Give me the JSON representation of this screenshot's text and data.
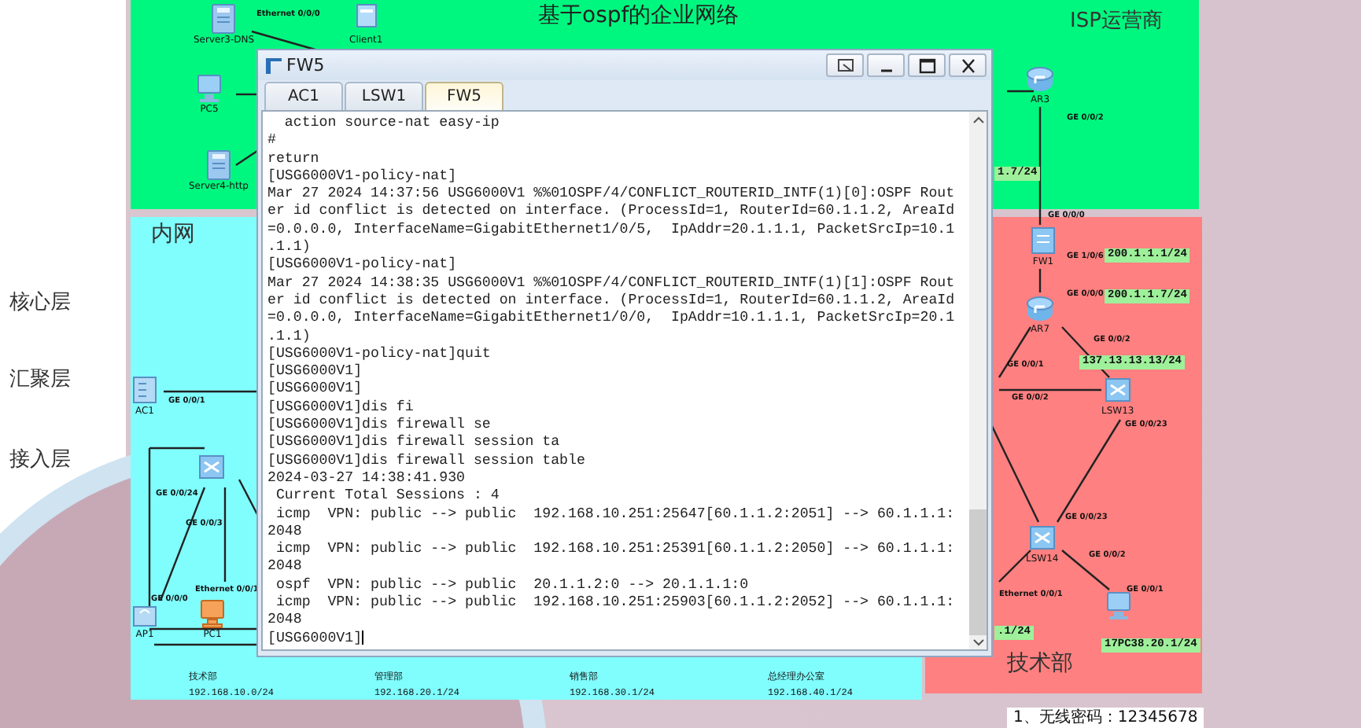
{
  "diagram": {
    "title": "基于ospf的企业网络",
    "zones": [
      {
        "kind": "isp",
        "label": "ISP运营商"
      },
      {
        "kind": "intranet",
        "label": "内网"
      },
      {
        "kind": "tech",
        "label": "技术部"
      }
    ],
    "layers": [
      "核心层",
      "汇聚层",
      "接入层"
    ],
    "devices": [
      {
        "kind": "server",
        "label": "Server3-DNS"
      },
      {
        "kind": "pc",
        "label": "PC5"
      },
      {
        "kind": "server",
        "label": "Server4-http"
      },
      {
        "kind": "client",
        "label": "Client1"
      },
      {
        "kind": "router",
        "label": "AR3"
      },
      {
        "kind": "firewall",
        "label": "FW1"
      },
      {
        "kind": "router",
        "label": "AR7"
      },
      {
        "kind": "switch",
        "label": "LSW13"
      },
      {
        "kind": "switch",
        "label": "LSW14"
      },
      {
        "kind": "pc"
      },
      {
        "kind": "ac",
        "label": "AC1"
      },
      {
        "kind": "switch"
      },
      {
        "kind": "ap",
        "label": "AP1"
      },
      {
        "kind": "pc",
        "label": "PC1"
      }
    ],
    "ports": [
      "Ethernet 0/0/0",
      "GE 0/0/2",
      "GE 0/0/0",
      "GE 1/0/6",
      "GE 0/0/0",
      "GE 0/0/2",
      "GE 0/0/1",
      "GE 0/0/2",
      "GE 0/0/23",
      "GE 0/0/23",
      "GE 0/0/2",
      "Ethernet 0/0/1",
      "GE 0/0/1",
      "GE 0/0/1",
      "GE 0/0/24",
      "GE 0/0/3",
      "Ethernet 0/0/1",
      "GE 0/0/0"
    ],
    "ip_tags": [
      "1.7/24",
      "200.1.1.1/24",
      "200.1.1.7/24",
      "137.13.13.13/24",
      ".1/24",
      "17PC38.20.1/24"
    ],
    "departments": [
      {
        "name": "技术部",
        "subnet": "192.168.10.0/24"
      },
      {
        "name": "管理部",
        "subnet": "192.168.20.1/24"
      },
      {
        "name": "销售部",
        "subnet": "192.168.30.1/24"
      },
      {
        "name": "总经理办公室",
        "subnet": "192.168.40.1/24"
      }
    ],
    "note": "1、无线密码：12345678"
  },
  "window": {
    "title": "FW5",
    "tabs": [
      {
        "label": "AC1",
        "selected": false
      },
      {
        "label": "LSW1",
        "selected": false
      },
      {
        "label": "FW5",
        "selected": true
      }
    ],
    "terminal_lines": [
      "  action source-nat easy-ip",
      "#",
      "return",
      "[USG6000V1-policy-nat]",
      "Mar 27 2024 14:37:56 USG6000V1 %%01OSPF/4/CONFLICT_ROUTERID_INTF(1)[0]:OSPF Rout",
      "er id conflict is detected on interface. (ProcessId=1, RouterId=60.1.1.2, AreaId",
      "=0.0.0.0, InterfaceName=GigabitEthernet1/0/5,  IpAddr=20.1.1.1, PacketSrcIp=10.1",
      ".1.1)",
      "[USG6000V1-policy-nat]",
      "Mar 27 2024 14:38:35 USG6000V1 %%01OSPF/4/CONFLICT_ROUTERID_INTF(1)[1]:OSPF Rout",
      "er id conflict is detected on interface. (ProcessId=1, RouterId=60.1.1.2, AreaId",
      "=0.0.0.0, InterfaceName=GigabitEthernet1/0/0,  IpAddr=10.1.1.1, PacketSrcIp=20.1",
      ".1.1)",
      "[USG6000V1-policy-nat]quit",
      "[USG6000V1]",
      "[USG6000V1]",
      "[USG6000V1]dis fi",
      "[USG6000V1]dis firewall se",
      "[USG6000V1]dis firewall session ta",
      "[USG6000V1]dis firewall session table",
      "2024-03-27 14:38:41.930",
      " Current Total Sessions : 4",
      " icmp  VPN: public --> public  192.168.10.251:25647[60.1.1.2:2051] --> 60.1.1.1:",
      "2048",
      " icmp  VPN: public --> public  192.168.10.251:25391[60.1.1.2:2050] --> 60.1.1.1:",
      "2048",
      " ospf  VPN: public --> public  20.1.1.2:0 --> 20.1.1.1:0",
      " icmp  VPN: public --> public  192.168.10.251:25903[60.1.1.2:2052] --> 60.1.1.1:",
      "2048",
      "[USG6000V1]"
    ]
  }
}
